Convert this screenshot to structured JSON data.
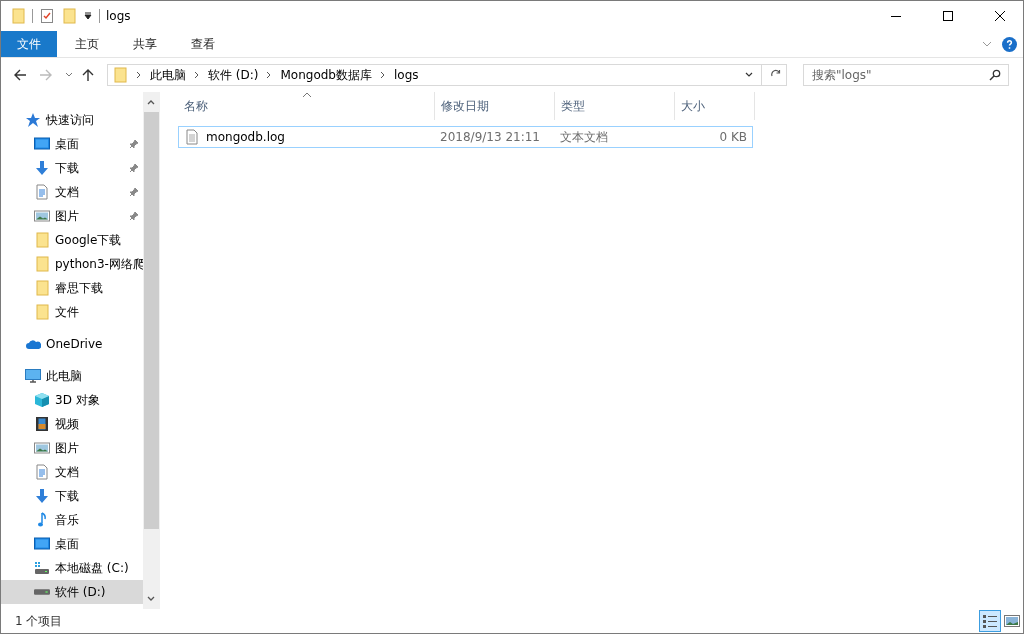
{
  "window": {
    "title": "logs"
  },
  "ribbon_tabs": [
    {
      "label": "文件",
      "selected": true
    },
    {
      "label": "主页",
      "selected": false
    },
    {
      "label": "共享",
      "selected": false
    },
    {
      "label": "查看",
      "selected": false
    }
  ],
  "address": {
    "crumbs": [
      "此电脑",
      "软件 (D:)",
      "Mongodb数据库",
      "logs"
    ]
  },
  "search": {
    "placeholder": "搜索\"logs\""
  },
  "sidebar": {
    "items": [
      {
        "label": "快速访问",
        "kind": "star",
        "selected": false,
        "children": [
          {
            "label": "桌面",
            "kind": "desktop",
            "pinned": true,
            "selected": false
          },
          {
            "label": "下载",
            "kind": "download",
            "pinned": true,
            "selected": false
          },
          {
            "label": "文档",
            "kind": "document",
            "pinned": true,
            "selected": false
          },
          {
            "label": "图片",
            "kind": "picture",
            "pinned": true,
            "selected": false
          },
          {
            "label": "Google下载",
            "kind": "folder",
            "pinned": false,
            "selected": false
          },
          {
            "label": "python3-网络爬",
            "kind": "folder",
            "pinned": false,
            "selected": false
          },
          {
            "label": "睿思下载",
            "kind": "folder",
            "pinned": false,
            "selected": false
          },
          {
            "label": "文件",
            "kind": "folder",
            "pinned": false,
            "selected": false
          }
        ]
      },
      {
        "label": "OneDrive",
        "kind": "cloud",
        "selected": false
      },
      {
        "label": "此电脑",
        "kind": "computer",
        "selected": false,
        "children": [
          {
            "label": "3D 对象",
            "kind": "cube",
            "selected": false
          },
          {
            "label": "视频",
            "kind": "video",
            "selected": false
          },
          {
            "label": "图片",
            "kind": "picture",
            "selected": false
          },
          {
            "label": "文档",
            "kind": "document",
            "selected": false
          },
          {
            "label": "下载",
            "kind": "download",
            "selected": false
          },
          {
            "label": "音乐",
            "kind": "music",
            "selected": false
          },
          {
            "label": "桌面",
            "kind": "desktop",
            "selected": false
          },
          {
            "label": "本地磁盘 (C:)",
            "kind": "system-drive",
            "selected": false
          },
          {
            "label": "软件 (D:)",
            "kind": "drive",
            "selected": true
          }
        ]
      }
    ]
  },
  "table": {
    "columns": [
      "名称",
      "修改日期",
      "类型",
      "大小"
    ],
    "rows": [
      {
        "cells": [
          "mongodb.log",
          "2018/9/13 21:11",
          "文本文档",
          "0 KB"
        ],
        "focused": true
      }
    ]
  },
  "status_bar": {
    "text": "1 个项目"
  },
  "view_buttons": [
    {
      "kind": "details",
      "selected": true
    },
    {
      "kind": "large-icons",
      "selected": false
    }
  ]
}
